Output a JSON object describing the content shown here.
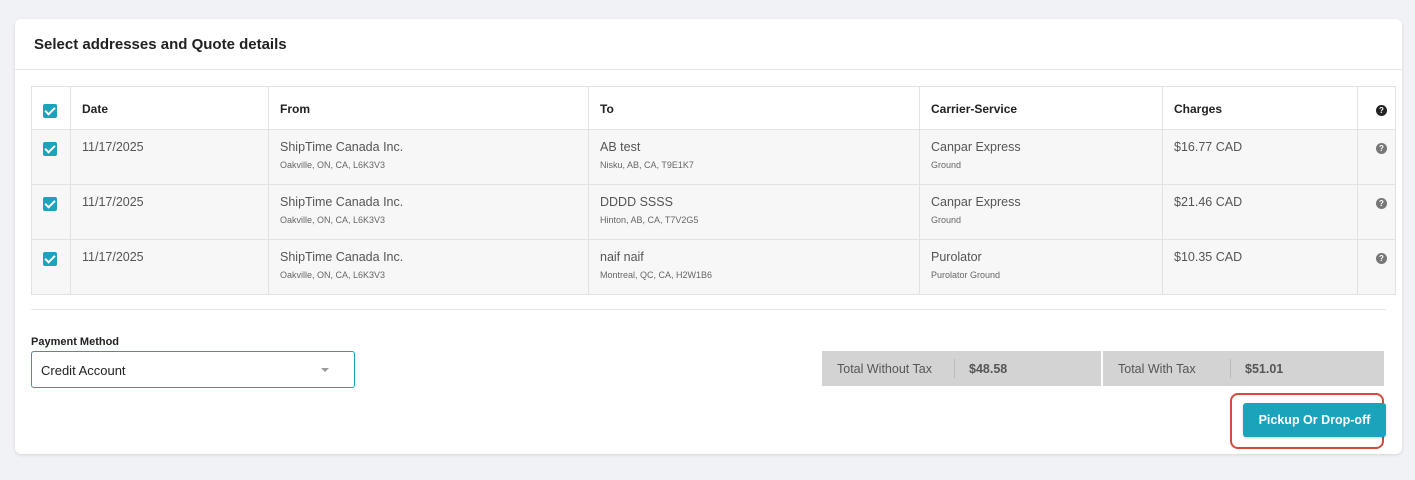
{
  "card": {
    "title": "Select addresses and Quote details"
  },
  "table": {
    "headers": {
      "date": "Date",
      "from": "From",
      "to": "To",
      "carrier": "Carrier-Service",
      "charges": "Charges",
      "help": "?"
    },
    "rows": [
      {
        "date": "11/17/2025",
        "from_name": "ShipTime Canada Inc.",
        "from_addr": "Oakville, ON, CA, L6K3V3",
        "to_name": "AB test",
        "to_addr": "Nisku, AB, CA, T9E1K7",
        "carrier": "Canpar Express",
        "service": "Ground",
        "charge": "$16.77 CAD",
        "help": "?"
      },
      {
        "date": "11/17/2025",
        "from_name": "ShipTime Canada Inc.",
        "from_addr": "Oakville, ON, CA, L6K3V3",
        "to_name": "DDDD SSSS",
        "to_addr": "Hinton, AB, CA, T7V2G5",
        "carrier": "Canpar Express",
        "service": "Ground",
        "charge": "$21.46 CAD",
        "help": "?"
      },
      {
        "date": "11/17/2025",
        "from_name": "ShipTime Canada Inc.",
        "from_addr": "Oakville, ON, CA, L6K3V3",
        "to_name": "naif naif",
        "to_addr": "Montreal, QC, CA, H2W1B6",
        "carrier": "Purolator",
        "service": "Purolator Ground",
        "charge": "$10.35 CAD",
        "help": "?"
      }
    ]
  },
  "payment": {
    "label": "Payment Method",
    "selected": "Credit Account"
  },
  "totals": {
    "without_tax_label": "Total Without Tax",
    "without_tax_value": "$48.58",
    "with_tax_label": "Total With Tax",
    "with_tax_value": "$51.01"
  },
  "actions": {
    "pickup_label": "Pickup Or Drop-off"
  },
  "colors": {
    "accent": "#1aa3bb",
    "highlight": "#d44b3a"
  }
}
